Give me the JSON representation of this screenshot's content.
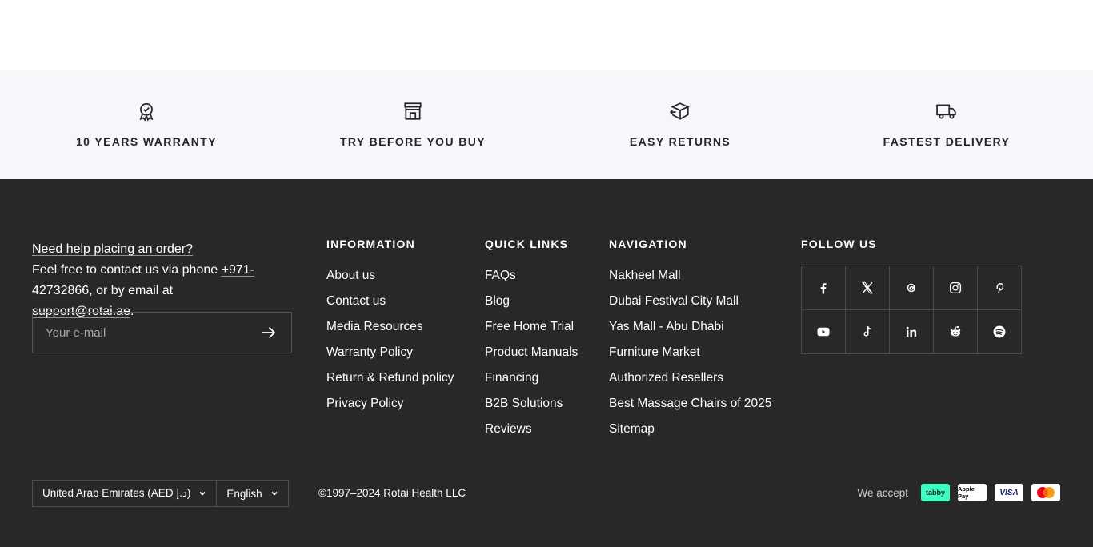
{
  "features": [
    {
      "icon": "award-ribbon-icon",
      "label": "10 YEARS WARRANTY"
    },
    {
      "icon": "store-icon",
      "label": "TRY BEFORE YOU BUY"
    },
    {
      "icon": "return-box-icon",
      "label": "EASY RETURNS"
    },
    {
      "icon": "delivery-truck-icon",
      "label": "FASTEST DELIVERY"
    }
  ],
  "help": {
    "heading": "Need help placing an order?",
    "text_before_phone": "Feel free to contact us via phone ",
    "phone": "+971-42732866,",
    "text_middle": " or by email at ",
    "email": "support@rotai.ae",
    "text_end": "."
  },
  "newsletter": {
    "placeholder": "Your e-mail"
  },
  "information": {
    "title": "INFORMATION",
    "links": [
      "About us",
      "Contact us",
      "Media Resources",
      "Warranty Policy",
      "Return & Refund policy",
      "Privacy Policy"
    ]
  },
  "quick_links": {
    "title": "QUICK LINKS",
    "links": [
      "FAQs",
      "Blog",
      "Free Home Trial",
      "Product Manuals",
      "Financing",
      "B2B Solutions",
      "Reviews"
    ]
  },
  "navigation": {
    "title": "NAVIGATION",
    "links": [
      "Nakheel Mall",
      "Dubai Festival City Mall",
      "Yas Mall - Abu Dhabi",
      "Furniture Market",
      "Authorized Resellers",
      "Best Massage Chairs of 2025",
      "Sitemap"
    ]
  },
  "follow": {
    "title": "FOLLOW US",
    "icons": [
      "facebook-icon",
      "x-twitter-icon",
      "threads-icon",
      "instagram-icon",
      "pinterest-icon",
      "youtube-icon",
      "tiktok-icon",
      "linkedin-icon",
      "reddit-icon",
      "spotify-icon"
    ]
  },
  "bottom": {
    "country": "United Arab Emirates (AED د.إ)",
    "language": "English",
    "copyright": "©1997–2024 Rotai Health LLC",
    "we_accept": "We accept",
    "payments": [
      {
        "name": "tabby",
        "bg": "#3bffc1",
        "fg": "#1c1c1c"
      },
      {
        "name": "Apple Pay",
        "bg": "#ffffff",
        "fg": "#000000"
      },
      {
        "name": "VISA",
        "bg": "#ffffff",
        "fg": "#1a1f71"
      },
      {
        "name": "mastercard",
        "bg": "#ffffff",
        "fg": "#000000"
      }
    ]
  },
  "colors": {
    "footer_bg": "#282828",
    "features_bg": "#f6f7fb",
    "text_dark": "#262626"
  }
}
